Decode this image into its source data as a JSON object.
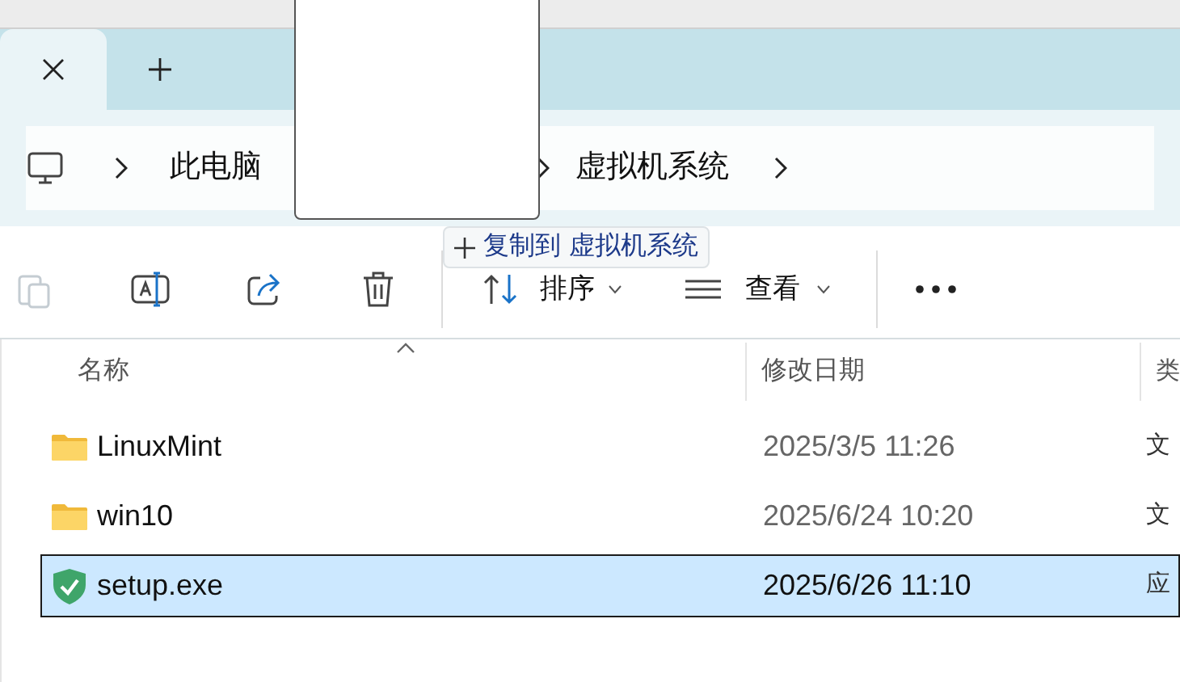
{
  "breadcrumb": [
    "此电脑",
    "虚拟机系统"
  ],
  "drag_tooltip": {
    "action": "复制到",
    "target": "虚拟机系统"
  },
  "toolbar": {
    "sort": "排序",
    "view": "查看"
  },
  "columns": [
    "名称",
    "修改日期",
    "类"
  ],
  "rows": [
    {
      "kind": "folder",
      "name": "LinuxMint",
      "modified": "2025/3/5 11:26",
      "column_3": "文",
      "selected": false
    },
    {
      "kind": "folder",
      "name": "win10",
      "modified": "2025/6/24 10:20",
      "column_3": "文",
      "selected": false
    },
    {
      "kind": "exe",
      "name": "setup.exe",
      "modified": "2025/6/26 11:10",
      "column_3": "应",
      "selected": true
    }
  ]
}
